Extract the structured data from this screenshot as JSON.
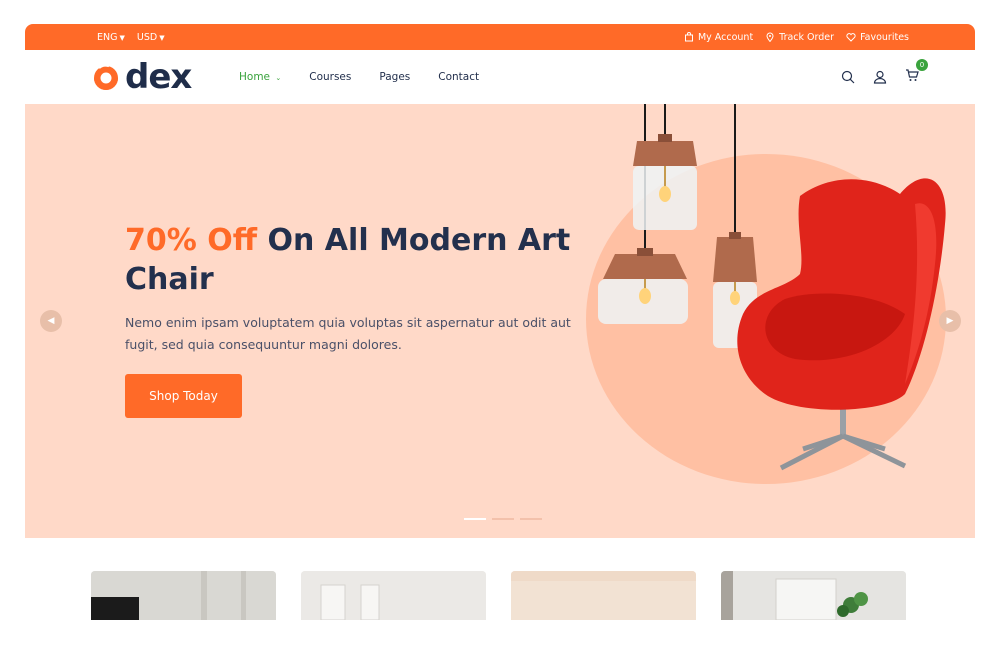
{
  "topbar": {
    "language": "ENG",
    "currency": "USD",
    "links": [
      {
        "label": "My Account",
        "icon": "bag-icon"
      },
      {
        "label": "Track Order",
        "icon": "location-pin-icon"
      },
      {
        "label": "Favourites",
        "icon": "heart-icon"
      }
    ]
  },
  "header": {
    "logo_text": "dex",
    "nav": [
      "Home",
      "Courses",
      "Pages",
      "Contact"
    ],
    "active_nav": "Home",
    "cart_count": "0",
    "icons": [
      "search-icon",
      "user-icon",
      "cart-icon"
    ]
  },
  "hero": {
    "headline_accent": "70% Off",
    "headline_rest": " On All Modern Art Chair",
    "description": "Nemo enim ipsam voluptatem quia voluptas sit aspernatur aut odit aut fugit, sed quia consequuntur magni dolores.",
    "button_label": "Shop Today",
    "slide_count": 3,
    "active_slide": 1
  },
  "colors": {
    "brand": "#ff6a28",
    "active_nav": "#3aa33d",
    "hero_bg": "#ffd9c8",
    "text_dark": "#23304d"
  }
}
